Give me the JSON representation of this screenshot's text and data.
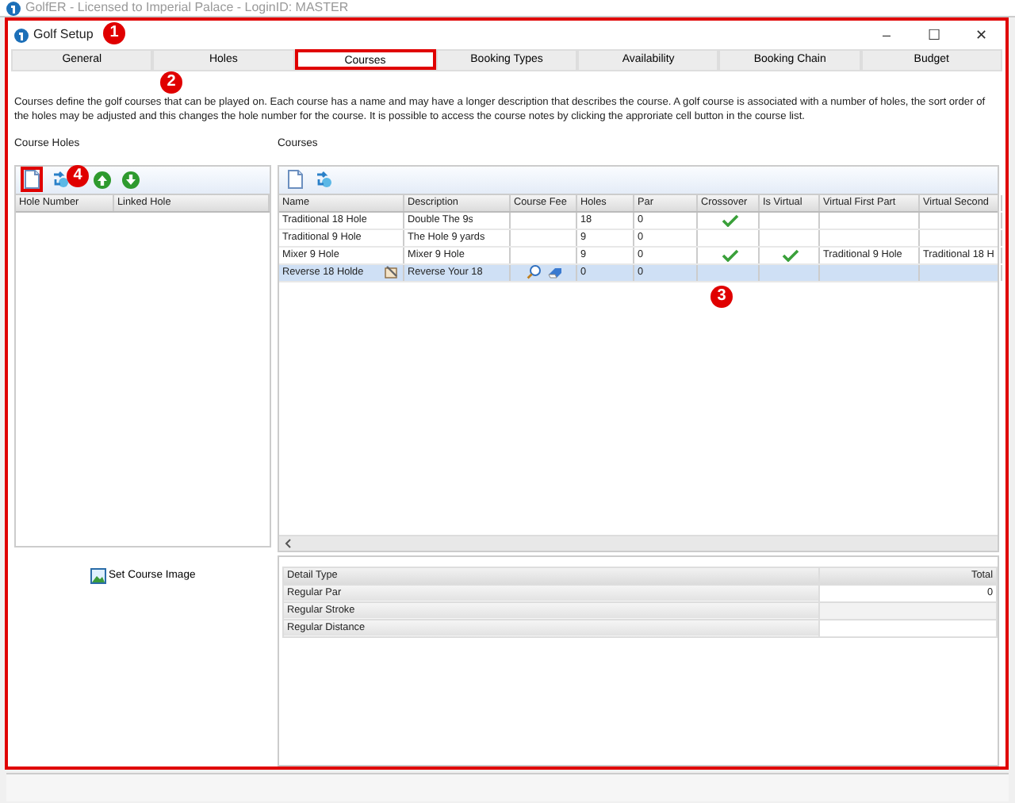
{
  "app_window": {
    "title": "GolfER - Licensed to Imperial Palace - LoginID: MASTER"
  },
  "dialog": {
    "title": "Golf Setup",
    "highlighted": true,
    "marker": "1",
    "controls": [
      "–",
      "☐",
      "✕"
    ]
  },
  "tabs": [
    {
      "label": "General",
      "selected": false,
      "highlighted": false
    },
    {
      "label": "Holes",
      "selected": false,
      "highlighted": false,
      "marker": "2"
    },
    {
      "label": "Courses",
      "selected": true,
      "highlighted": true
    },
    {
      "label": "Booking Types",
      "selected": false,
      "highlighted": false
    },
    {
      "label": "Availability",
      "selected": false,
      "highlighted": false
    },
    {
      "label": "Booking Chain",
      "selected": false,
      "highlighted": false
    },
    {
      "label": "Budget",
      "selected": false,
      "highlighted": false
    }
  ],
  "description": "Courses define the golf courses that can be played on. Each course has a name and may have a longer description that describes the course. A golf course is associated with a number of holes, the sort order of the holes may be adjusted and this changes the hole number for the course. It is possible to access the course notes by clicking the approriate cell button in the course list.",
  "course_holes": {
    "title": "Course Holes",
    "toolbar": [
      {
        "kind": "new",
        "highlighted": true,
        "marker": "4"
      },
      {
        "kind": "link",
        "highlighted": false
      },
      {
        "kind": "up",
        "highlighted": false
      },
      {
        "kind": "down",
        "highlighted": false
      }
    ],
    "columns": [
      "Hole Number",
      "Linked Hole"
    ]
  },
  "courses": {
    "title": "Courses",
    "marker": "3",
    "toolbar": [
      {
        "kind": "new"
      },
      {
        "kind": "link"
      }
    ],
    "columns": [
      "Name",
      "Description",
      "Course Fee",
      "Holes",
      "Par",
      "Crossover",
      "Is Virtual",
      "Virtual First Part",
      "Virtual Second"
    ],
    "rows": [
      {
        "name": "Traditional 18 Hole",
        "description": "Double The 9s",
        "holes": "18",
        "par": "0",
        "crossover": true,
        "is_virtual": false,
        "virtual_first_part": "",
        "virtual_second_part": "",
        "selected": false
      },
      {
        "name": "Traditional 9 Hole",
        "description": "The Hole 9 yards",
        "holes": "9",
        "par": "0",
        "crossover": false,
        "is_virtual": false,
        "virtual_first_part": "",
        "virtual_second_part": "",
        "selected": false
      },
      {
        "name": "Mixer 9 Hole",
        "description": "Mixer 9 Hole",
        "holes": "9",
        "par": "0",
        "crossover": true,
        "is_virtual": true,
        "virtual_first_part": "Traditional 9 Hole",
        "virtual_second_part": "Traditional 18 H",
        "selected": false
      },
      {
        "name": "Reverse 18 Holde",
        "description": "Reverse Your 18",
        "holes": "0",
        "par": "0",
        "crossover": false,
        "is_virtual": false,
        "virtual_first_part": "",
        "virtual_second_part": "",
        "selected": true
      }
    ]
  },
  "set_course_image": "Set Course Image",
  "details": {
    "columns": [
      "Detail Type",
      "Total"
    ],
    "rows": [
      {
        "type": "Regular Par",
        "total": "0"
      },
      {
        "type": "Regular Stroke",
        "total": ""
      },
      {
        "type": "Regular Distance",
        "total": ""
      }
    ]
  }
}
